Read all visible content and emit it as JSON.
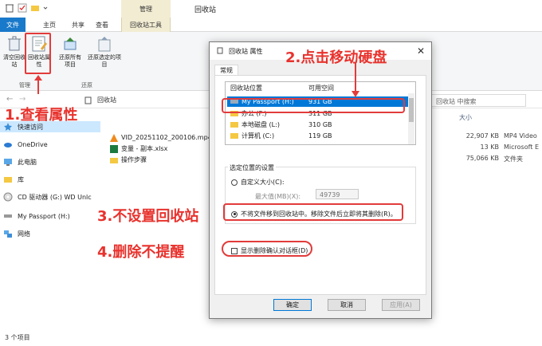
{
  "window": {
    "context_tab": "管理",
    "title": "回收站"
  },
  "ribbon_tabs": [
    "文件",
    "主页",
    "共享",
    "查看",
    "回收站工具"
  ],
  "ribbon": {
    "buttons": [
      {
        "label": "清空回收站"
      },
      {
        "label": "回收站属性"
      },
      {
        "label": "还原所有项目"
      },
      {
        "label": "还原选定的项目"
      }
    ],
    "groups": [
      "管理",
      "还原"
    ]
  },
  "address": {
    "path": "回收站",
    "search_placeholder": "回收站 中搜索"
  },
  "sidebar": {
    "items": [
      {
        "label": "快速访问"
      },
      {
        "label": "OneDrive"
      },
      {
        "label": "此电脑"
      },
      {
        "label": "库"
      },
      {
        "label": "CD 驱动器 (G:) WD Unlc"
      },
      {
        "label": "My Passport (H:)"
      },
      {
        "label": "网络"
      }
    ]
  },
  "filelist": {
    "headers": {
      "size": "大小"
    },
    "rows": [
      {
        "name": "VID_20251102_200106.mp4",
        "size": "22,907 KB",
        "type": "MP4 Video"
      },
      {
        "name": "变量 - 副本.xlsx",
        "size": "13 KB",
        "type": "Microsoft E"
      },
      {
        "name": "操作步骤",
        "size": "75,066 KB",
        "type": "文件夹"
      }
    ]
  },
  "status": {
    "count": "3 个项目"
  },
  "dialog": {
    "title": "回收站 属性",
    "tab": "常规",
    "columns": [
      "回收站位置",
      "可用空间"
    ],
    "locations": [
      {
        "name": "My Passport (H:)",
        "free": "931 GB",
        "selected": true
      },
      {
        "name": "办公 (F:)",
        "free": "311 GB",
        "selected": false
      },
      {
        "name": "本地磁盘 (L:)",
        "free": "310 GB",
        "selected": false
      },
      {
        "name": "计算机 (C:)",
        "free": "119 GB",
        "selected": false
      }
    ],
    "settings_legend": "选定位置的设置",
    "custom_size_label": "自定义大小(C):",
    "max_size_label": "最大值(MB)(X):",
    "max_size_value": "49739",
    "no_recycle_label": "不将文件移到回收站中。移除文件后立即将其删除(R)。",
    "confirm_label": "显示删除确认对话框(D)",
    "ok_label": "确定",
    "cancel_label": "取消",
    "apply_label": "应用(A)"
  },
  "annotations": {
    "step1": "1.查看属性",
    "step2": "2.点击移动硬盘",
    "step3": "3.不设置回收站",
    "step4": "4.删除不提醒"
  },
  "colors": {
    "annotation": "#e8322d",
    "selection": "#0078d7",
    "file_tab": "#1979ca"
  }
}
